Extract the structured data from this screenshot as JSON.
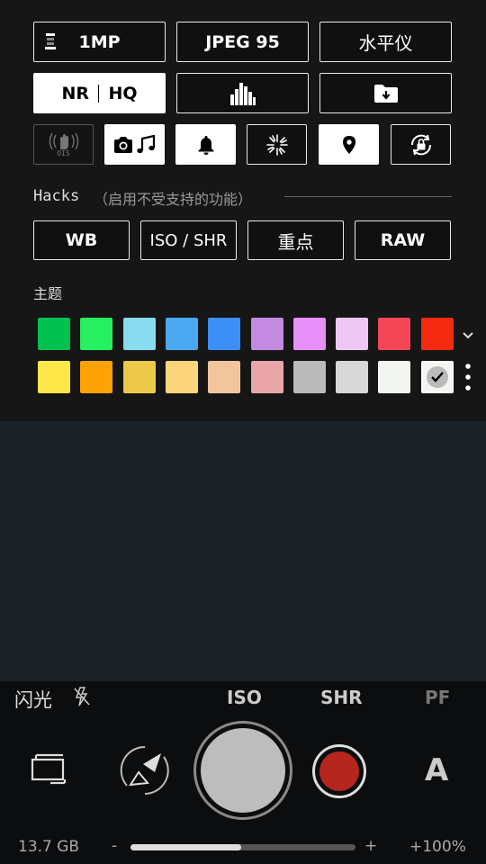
{
  "row1": {
    "resolution": "1MP",
    "format": "JPEG 95",
    "level": "水平仪"
  },
  "row2": {
    "nr": "NR",
    "hq": "HQ",
    "histogram_icon": "histogram-icon",
    "save_icon": "folder-download-icon"
  },
  "row3": {
    "ois_label": "OIS",
    "icons": [
      "ois-hand-icon",
      "camera-music-icon",
      "bell-icon",
      "sparkle-icon",
      "location-pin-icon",
      "lock-rotate-icon"
    ]
  },
  "hacks": {
    "title": "Hacks",
    "hint": "（启用不受支持的功能）",
    "buttons": [
      "WB",
      "ISO / SHR",
      "重点",
      "RAW"
    ]
  },
  "theme": {
    "title": "主题",
    "row1": [
      "#00c050",
      "#27f060",
      "#87dcf0",
      "#4aa8f0",
      "#3d8ff8",
      "#c38be0",
      "#e88ff8",
      "#edc8f5",
      "#f54655",
      "#f52a10"
    ],
    "row2": [
      "#fde84a",
      "#ffa205",
      "#ecc949",
      "#fdd67b",
      "#f3c59d",
      "#e9a7aa",
      "#bbbbbb",
      "#d8d8d8",
      "#f3f5f0",
      "#f3f5f0"
    ],
    "selected_index": 19
  },
  "bottom": {
    "flash_label": "闪光",
    "modes": [
      "ISO",
      "SHR",
      "PF"
    ],
    "storage": "13.7 GB",
    "minus": "-",
    "plus": "+",
    "exposure": "+100%",
    "auto_label": "A",
    "slider_fraction": 0.49
  }
}
